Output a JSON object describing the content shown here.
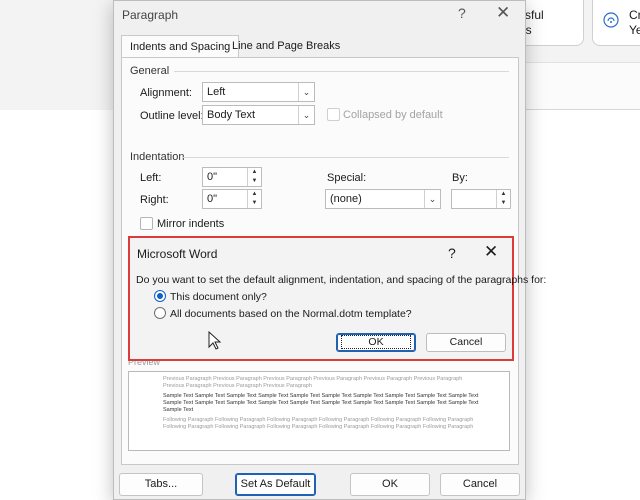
{
  "background": {
    "card1_text": "ssful\nns",
    "card2_text": "Cr\nYe",
    "card2_icon": "wireless-icon"
  },
  "paragraph_dialog": {
    "title": "Paragraph",
    "help": "?",
    "close": "✕",
    "tabs": [
      "Indents and Spacing",
      "Line and Page Breaks"
    ],
    "general": {
      "heading": "General",
      "alignment_label": "Alignment:",
      "alignment_value": "Left",
      "outline_label": "Outline level:",
      "outline_value": "Body Text",
      "collapsed_label": "Collapsed by default"
    },
    "indentation": {
      "heading": "Indentation",
      "left_label": "Left:",
      "left_value": "0\"",
      "right_label": "Right:",
      "right_value": "0\"",
      "special_label": "Special:",
      "special_value": "(none)",
      "by_label": "By:",
      "by_value": "",
      "mirror_label": "Mirror indents"
    },
    "preview": {
      "heading": "Preview",
      "previous": "Previous Paragraph Previous Paragraph Previous Paragraph Previous Paragraph Previous Paragraph Previous Paragraph Previous Paragraph Previous Paragraph Previous Paragraph",
      "sample": "Sample Text Sample Text Sample Text Sample Text Sample Text Sample Text Sample Text Sample Text Sample Text Sample Text Sample Text Sample Text Sample Text Sample Text Sample Text Sample Text Sample Text Sample Text Sample Text Sample Text Sample Text",
      "following": "Following Paragraph Following Paragraph Following Paragraph Following Paragraph Following Paragraph Following Paragraph Following Paragraph Following Paragraph Following Paragraph Following Paragraph Following Paragraph Following Paragraph"
    },
    "buttons": {
      "tabs": "Tabs...",
      "set_default": "Set As Default",
      "ok": "OK",
      "cancel": "Cancel"
    }
  },
  "confirm_dialog": {
    "title": "Microsoft Word",
    "help": "?",
    "close": "✕",
    "question": "Do you want to set the default alignment, indentation, and spacing of the paragraphs for:",
    "option1": "This document only?",
    "option2": "All documents based on the Normal.dotm template?",
    "ok": "OK",
    "cancel": "Cancel",
    "selected_option": 1,
    "highlight_color": "#dd3a3a"
  }
}
